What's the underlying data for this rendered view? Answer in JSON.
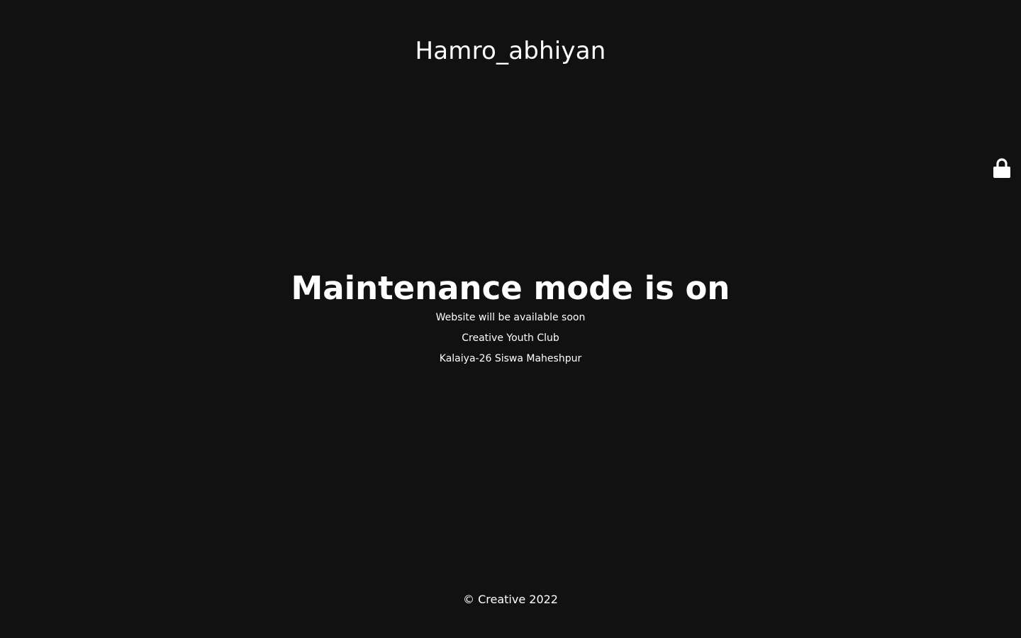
{
  "header": {
    "site_title": "Hamro_abhiyan"
  },
  "main": {
    "headline": "Maintenance mode is on",
    "subtitle": "Website will be available soon",
    "lines": [
      "Creative Youth Club",
      "Kalaiya-26 Siswa Maheshpur"
    ]
  },
  "footer": {
    "copyright": "© Creative 2022"
  },
  "login": {
    "icon": "lock-icon"
  },
  "colors": {
    "background": "#111111",
    "text": "#ffffff"
  }
}
